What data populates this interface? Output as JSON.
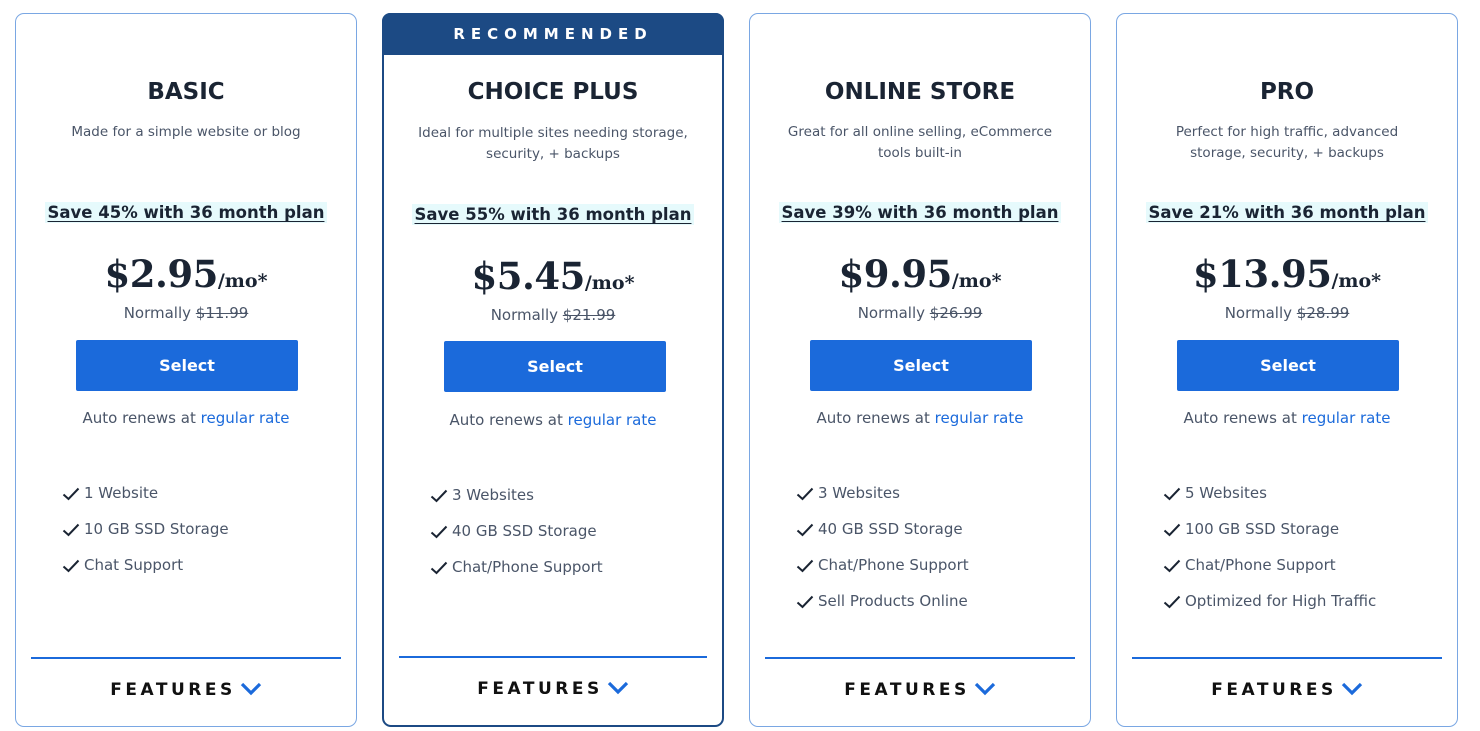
{
  "colors": {
    "accent": "#1b6adb",
    "recommended_banner": "#1c4a84",
    "card_border": "#7aa7e3",
    "save_highlight": "#e6fafc",
    "text_dark": "#1a2433",
    "text_muted": "#4a5568"
  },
  "plans": [
    {
      "name": "BASIC",
      "recommended": false,
      "description": "Made for a simple website or blog",
      "save_text": "Save 45% with 36 month plan",
      "price": "$2.95",
      "per": "/mo*",
      "normally_label": "Normally",
      "normally_price": "$11.99",
      "select_label": "Select",
      "renew_prefix": "Auto renews at",
      "renew_link": "regular rate",
      "features": [
        "1 Website",
        "10 GB SSD Storage",
        "Chat Support"
      ],
      "features_toggle": "FEATURES"
    },
    {
      "name": "CHOICE PLUS",
      "recommended": true,
      "banner": "RECOMMENDED",
      "description": "Ideal for multiple sites needing storage, security, + backups",
      "save_text": "Save 55% with 36 month plan",
      "price": "$5.45",
      "per": "/mo*",
      "normally_label": "Normally",
      "normally_price": "$21.99",
      "select_label": "Select",
      "renew_prefix": "Auto renews at",
      "renew_link": "regular rate",
      "features": [
        "3 Websites",
        "40 GB SSD Storage",
        "Chat/Phone Support"
      ],
      "features_toggle": "FEATURES"
    },
    {
      "name": "ONLINE STORE",
      "recommended": false,
      "description": "Great for all online selling, eCommerce tools built-in",
      "save_text": "Save 39% with 36 month plan",
      "price": "$9.95",
      "per": "/mo*",
      "normally_label": "Normally",
      "normally_price": "$26.99",
      "select_label": "Select",
      "renew_prefix": "Auto renews at",
      "renew_link": "regular rate",
      "features": [
        "3 Websites",
        "40 GB SSD Storage",
        "Chat/Phone Support",
        "Sell Products Online"
      ],
      "features_toggle": "FEATURES"
    },
    {
      "name": "PRO",
      "recommended": false,
      "description": "Perfect for high traffic, advanced storage, security, + backups",
      "save_text": "Save 21% with 36 month plan",
      "price": "$13.95",
      "per": "/mo*",
      "normally_label": "Normally",
      "normally_price": "$28.99",
      "select_label": "Select",
      "renew_prefix": "Auto renews at",
      "renew_link": "regular rate",
      "features": [
        "5 Websites",
        "100 GB SSD Storage",
        "Chat/Phone Support",
        "Optimized for High Traffic"
      ],
      "features_toggle": "FEATURES"
    }
  ]
}
